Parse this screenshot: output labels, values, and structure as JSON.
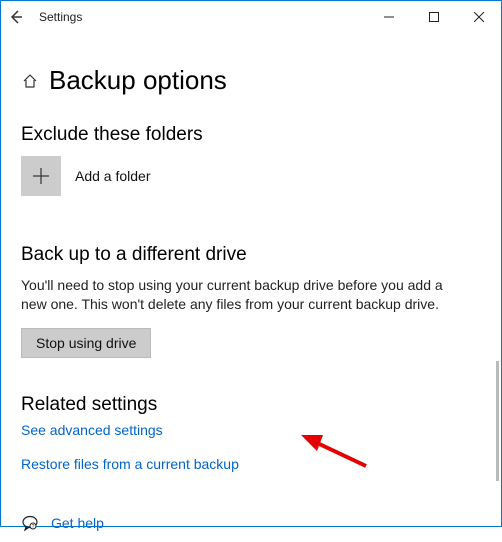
{
  "titlebar": {
    "app_name": "Settings"
  },
  "page": {
    "title": "Backup options"
  },
  "exclude": {
    "heading": "Exclude these folders",
    "add_label": "Add a folder"
  },
  "different_drive": {
    "heading": "Back up to a different drive",
    "body": "You'll need to stop using your current backup drive before you add a new one. This won't delete any files from your current backup drive.",
    "button": "Stop using drive"
  },
  "related": {
    "heading": "Related settings",
    "advanced_link": "See advanced settings",
    "restore_link": "Restore files from a current backup"
  },
  "help": {
    "label": "Get help"
  }
}
